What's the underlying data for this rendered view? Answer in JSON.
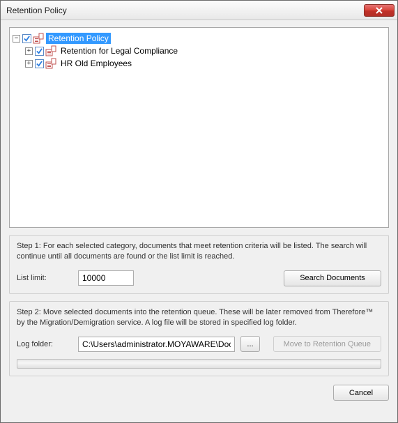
{
  "window": {
    "title": "Retention Policy"
  },
  "tree": {
    "root": {
      "label": "Retention Policy",
      "expanded": true,
      "checked": true,
      "selected": true,
      "children": [
        {
          "label": "Retention for Legal Compliance",
          "expanded": false,
          "checked": true
        },
        {
          "label": "HR Old Employees",
          "expanded": false,
          "checked": true
        }
      ]
    }
  },
  "step1": {
    "description": "Step 1: For each selected category, documents that meet retention criteria will be listed. The search will continue until all documents are found or the list limit is reached.",
    "list_limit_label": "List limit:",
    "list_limit_value": "10000",
    "search_button": "Search Documents"
  },
  "step2": {
    "description": "Step 2: Move selected documents into the retention queue. These will be later removed from Therefore™ by the Migration/Demigration service. A log file will be stored in specified log folder.",
    "log_folder_label": "Log folder:",
    "log_folder_value": "C:\\Users\\administrator.MOYAWARE\\Document",
    "browse_button": "...",
    "move_button": "Move to Retention Queue",
    "move_enabled": false
  },
  "footer": {
    "cancel": "Cancel"
  }
}
